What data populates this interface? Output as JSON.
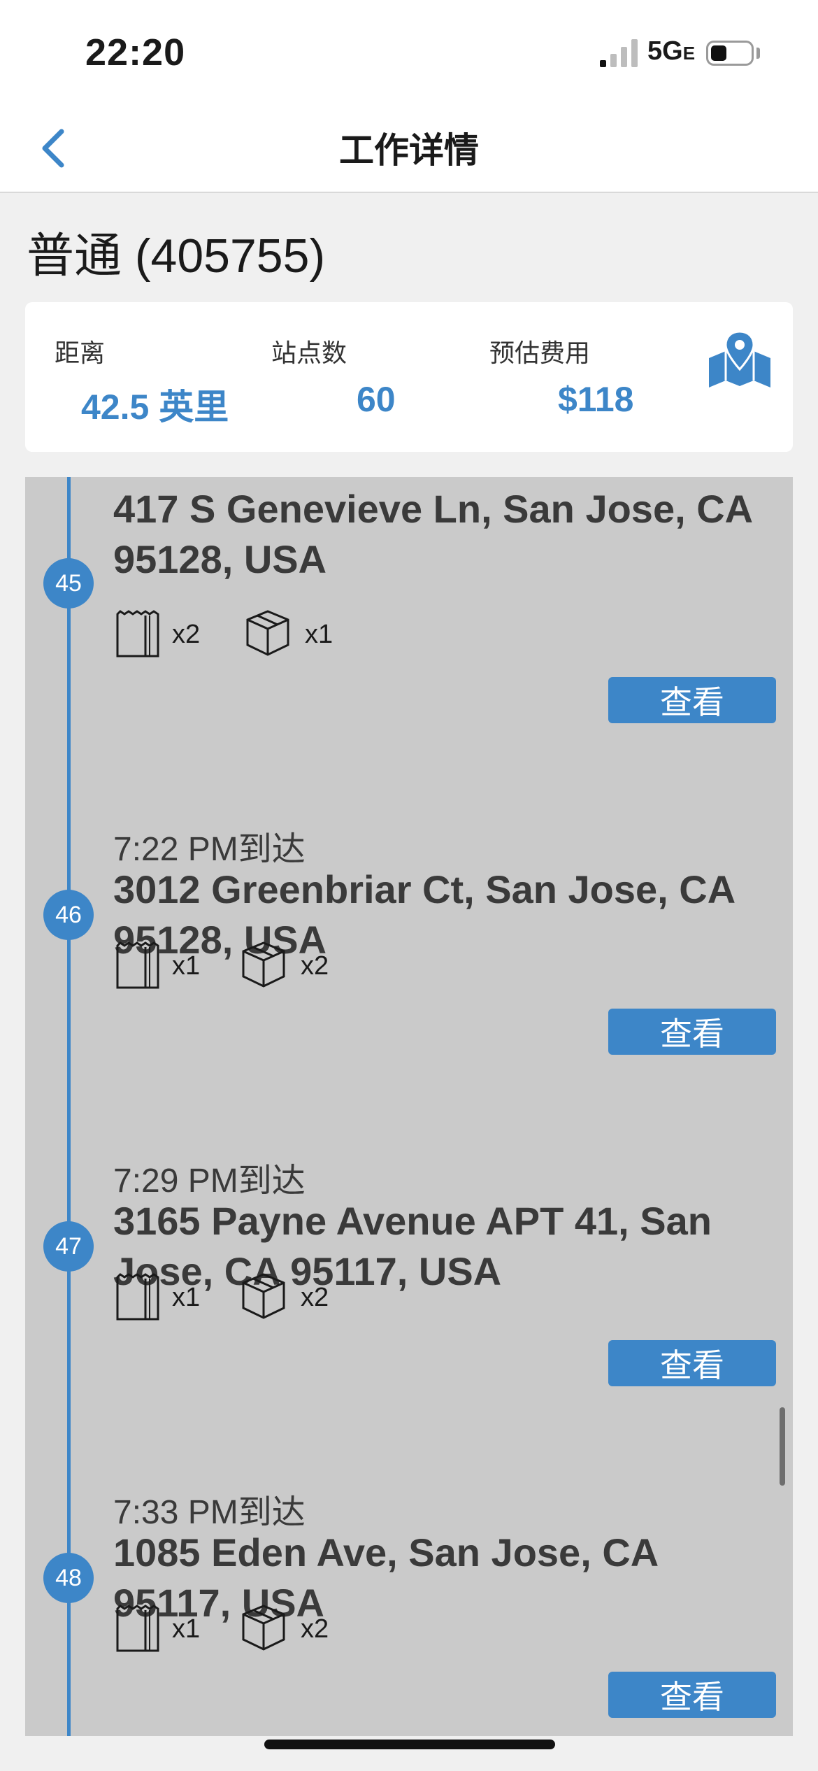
{
  "status_bar": {
    "time": "22:20",
    "network": "5G",
    "network_suffix": "E",
    "battery_level": 0.4
  },
  "nav": {
    "title": "工作详情",
    "back_icon": "chevron-left-icon"
  },
  "job": {
    "title": "普通 (405755)"
  },
  "summary": {
    "distance_label": "距离",
    "distance_value": "42.5 英里",
    "stops_label": "站点数",
    "stops_value": "60",
    "cost_label": "预估费用",
    "cost_value": "$118",
    "map_icon": "map-pin-icon"
  },
  "colors": {
    "accent": "#3d86c8",
    "list_bg": "#cacaca"
  },
  "stops": [
    {
      "number": "45",
      "eta": "",
      "address_line1": "417 S Genevieve Ln, San Jose, CA",
      "address_line2": "95128, USA",
      "bag_qty": "x2",
      "box_qty": "x1",
      "view_label": "查看"
    },
    {
      "number": "46",
      "eta": "7:22 PM到达",
      "address_line1": "3012 Greenbriar Ct, San Jose, CA",
      "address_line2": "95128, USA",
      "bag_qty": "x1",
      "box_qty": "x2",
      "view_label": "查看"
    },
    {
      "number": "47",
      "eta": "7:29 PM到达",
      "address_line1": "3165 Payne Avenue APT 41, San",
      "address_line2": "Jose, CA  95117, USA",
      "bag_qty": "x1",
      "box_qty": "x2",
      "view_label": "查看"
    },
    {
      "number": "48",
      "eta": "7:33 PM到达",
      "address_line1": "1085 Eden Ave, San Jose, CA",
      "address_line2": "95117, USA",
      "bag_qty": "x1",
      "box_qty": "x2",
      "view_label": "查看"
    }
  ]
}
